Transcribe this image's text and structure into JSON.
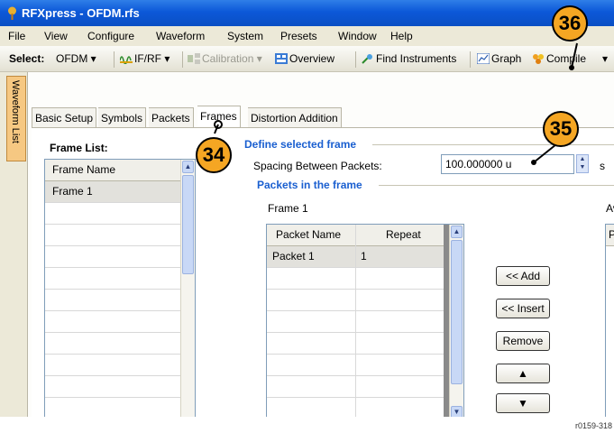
{
  "window": {
    "title": "RFXpress - OFDM.rfs"
  },
  "menu": [
    "File",
    "View",
    "Configure",
    "Waveform",
    "System",
    "Presets",
    "Window",
    "Help"
  ],
  "toolbar": {
    "select_label": "Select:",
    "select_value": "OFDM",
    "ifrf_label": "IF/RF",
    "calibration_label": "Calibration",
    "overview_label": "Overview",
    "find_instruments_label": "Find Instruments",
    "graph_label": "Graph",
    "compile_label": "Compile"
  },
  "side_tab": "Waveform List",
  "tabs": [
    "Basic Setup",
    "Symbols",
    "Packets",
    "Frames",
    "Distortion Addition"
  ],
  "active_tab": "Frames",
  "frame_list": {
    "title": "Frame List:",
    "header": "Frame Name",
    "items": [
      "Frame 1"
    ]
  },
  "define_frame": {
    "title": "Define selected frame",
    "spacing_label": "Spacing Between Packets:",
    "spacing_value": "100.000000 u",
    "spacing_unit": "s"
  },
  "packets_frame": {
    "title": "Packets in the frame",
    "frame_name": "Frame 1",
    "columns": [
      "Packet Name",
      "Repeat"
    ],
    "rows": [
      [
        "Packet 1",
        "1"
      ]
    ],
    "available_label": "Av",
    "available_header": "P"
  },
  "buttons": {
    "add": "<< Add",
    "insert": "<< Insert",
    "remove": "Remove",
    "up_icon": "up-arrow",
    "down_icon": "down-arrow"
  },
  "callouts": [
    "34",
    "35",
    "36"
  ],
  "figure_code": "r0159-318",
  "colors": {
    "titlebar": "#0c58d8",
    "callout": "#f5a623",
    "group_title": "#1a5fd0",
    "side_tab": "#f6c882"
  }
}
